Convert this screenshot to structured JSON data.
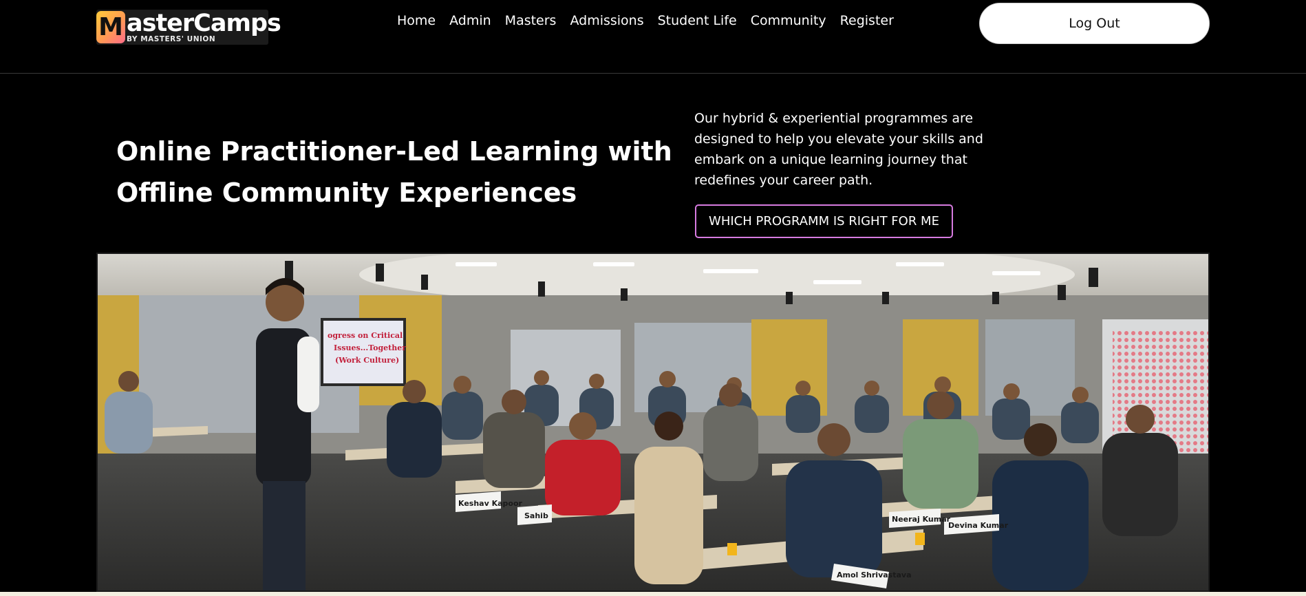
{
  "brand": {
    "logo_letter": "M",
    "logo_word": "asterCamps",
    "logo_sub": "BY MASTERS' UNION"
  },
  "nav": {
    "items": [
      "Home",
      "Admin",
      "Masters",
      "Admissions",
      "Student Life",
      "Community",
      "Register"
    ]
  },
  "header": {
    "logout_label": "Log Out"
  },
  "hero": {
    "title_line1": "Online Practitioner-Led Learning with",
    "title_line2": "Offline Community Experiences",
    "description": "Our hybrid & experiential programmes are designed to help you elevate your skills and embark on a unique learning journey that redefines your career path.",
    "cta_label": "WHICH PROGRAMM IS RIGHT FOR ME"
  },
  "photo": {
    "screen_text": [
      "ogress on Critical",
      "Issues...Together",
      "(Work Culture)"
    ],
    "name_cards": [
      "Keshav Kapoor",
      "Sahib",
      "Devina Kumar",
      "Neeraj Kumar",
      "Amol Shrivastava"
    ]
  },
  "colors": {
    "background": "#000000",
    "accent_border": "#d77be0",
    "logo_gradient_start": "#ffcb3a",
    "logo_gradient_end": "#ff6b8a"
  }
}
